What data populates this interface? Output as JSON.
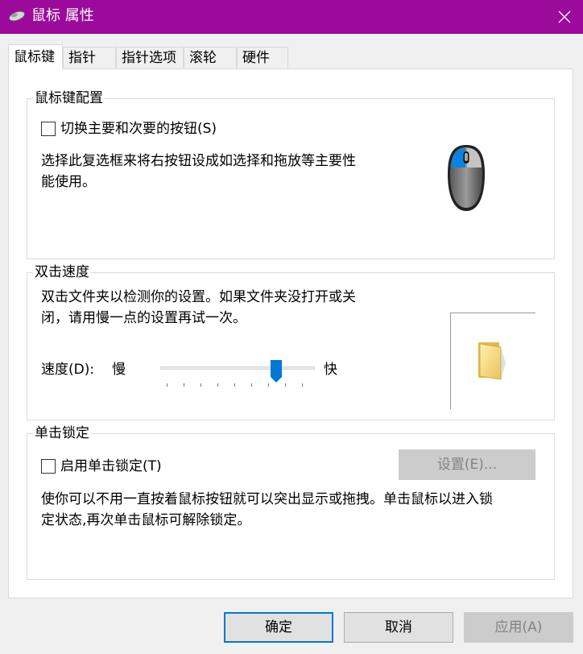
{
  "window": {
    "title": "鼠标 属性",
    "title_bar_color": "#9b0a9b"
  },
  "tabs": [
    {
      "label": "鼠标键",
      "active": true
    },
    {
      "label": "指针"
    },
    {
      "label": "指针选项"
    },
    {
      "label": "滚轮"
    },
    {
      "label": "硬件"
    }
  ],
  "button_config": {
    "group_title": "鼠标键配置",
    "checkbox_label": "切换主要和次要的按钮(S)",
    "checked": false,
    "description": "选择此复选框来将右按钮设成如选择和拖放等主要性\n能使用。"
  },
  "double_click": {
    "group_title": "双击速度",
    "description": "双击文件夹以检测你的设置。如果文件夹没打开或关\n闭，请用慢一点的设置再试一次。",
    "speed_label": "速度(D):",
    "slow_label": "慢",
    "fast_label": "快",
    "slider_value_fraction": 0.75
  },
  "click_lock": {
    "group_title": "单击锁定",
    "checkbox_label": "启用单击锁定(T)",
    "checked": false,
    "settings_button": "设置(E)...",
    "description": "使你可以不用一直按着鼠标按钮就可以突出显示或拖拽。单击鼠标以进入锁\n定状态,再次单击鼠标可解除锁定。"
  },
  "footer": {
    "ok": "确定",
    "cancel": "取消",
    "apply": "应用(A)"
  },
  "icons": {
    "app": "mouse-icon",
    "close": "close-icon",
    "mouse_illustration": "mouse-illustration-icon",
    "folder": "folder-icon"
  },
  "accent_color": "#0078d7"
}
